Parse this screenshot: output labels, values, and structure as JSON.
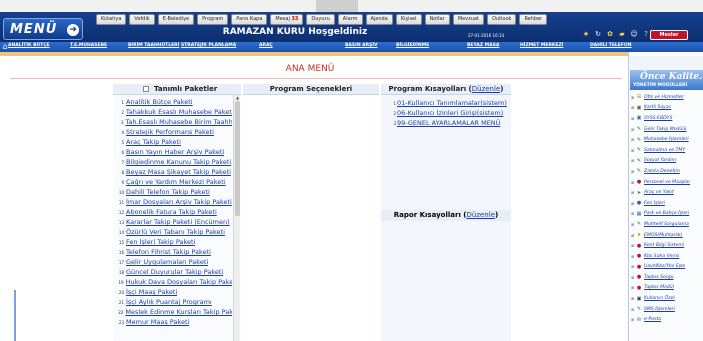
{
  "header": {
    "logo": "MENÜ",
    "welcome": "RAMAZAN KURU Hoşgeldiniz",
    "datetime": "27-01-2016 16:14",
    "user_badge": "Mesler",
    "menu_buttons": [
      {
        "label": "Kütahya",
        "badge": ""
      },
      {
        "label": "Vefdik",
        "badge": ""
      },
      {
        "label": "E-Belediye",
        "badge": ""
      },
      {
        "label": "Program",
        "badge": ""
      },
      {
        "label": "Pano Kapa",
        "badge": ""
      },
      {
        "label": "Mesaj",
        "badge": "33"
      },
      {
        "label": "Duyuru",
        "badge": ""
      },
      {
        "label": "Alarm",
        "badge": ""
      },
      {
        "label": "Ajanda",
        "badge": ""
      },
      {
        "label": "Kişisel",
        "badge": ""
      },
      {
        "label": "Notlar",
        "badge": ""
      },
      {
        "label": "Mevzuat",
        "badge": ""
      },
      {
        "label": "Outlook",
        "badge": ""
      },
      {
        "label": "Rehber",
        "badge": ""
      }
    ]
  },
  "shortcut_bar": [
    "ANALİTİK BÜTÇE",
    "T.E.MUHASEBE",
    "BİRİM TAAHHÜTLERİ",
    "STRATEJİK PLANLAMA",
    "ARAÇ",
    "BASIN ARŞİV",
    "BİLGİEDİNME",
    "BEYAZ MASA",
    "HİZMET MERKEZİ",
    "DAHİLİ TELEFON"
  ],
  "main": {
    "title": "ANA MENÜ",
    "col_packages": "Tanımlı Paketler",
    "col_options": "Program Seçenekleri",
    "col_shortcuts": "Program Kısayolları",
    "col_shortcuts_link": "Düzenle",
    "report_head": "Rapor Kısayolları",
    "report_link": "Düzenle",
    "packages": [
      {
        "n": "1",
        "label": "Analitik Bütçe Paketi"
      },
      {
        "n": "2",
        "label": "Tahakkuk Esaslı Muhasebe Paketi"
      },
      {
        "n": "3",
        "label": "Tah.Esaslı Muhasebe Birim Taahhüt"
      },
      {
        "n": "4",
        "label": "Stratejik Performans Paketi"
      },
      {
        "n": "5",
        "label": "Araç Takip Paketi"
      },
      {
        "n": "6",
        "label": "Basın Yayın Haber Arşiv Paketi"
      },
      {
        "n": "7",
        "label": "Bilgiedinme Kanunu Takip Paketi"
      },
      {
        "n": "8",
        "label": "Beyaz Masa Şikayet Takip Paketi"
      },
      {
        "n": "9",
        "label": "Çağrı ve Yardım Merkezi Paketi"
      },
      {
        "n": "10",
        "label": "Dahili Telefon Takip Paketi"
      },
      {
        "n": "11",
        "label": "İmar Dosyaları Arşiv Takip Paketi"
      },
      {
        "n": "12",
        "label": "Abonelik Fatura Takip Paketi"
      },
      {
        "n": "13",
        "label": "Kararlar Takip Paketi (Encümen)"
      },
      {
        "n": "14",
        "label": "Özürlü Veri Tabanı Takip Paketi"
      },
      {
        "n": "15",
        "label": "Fen İşleri Takip Paketi"
      },
      {
        "n": "16",
        "label": "Telefon Fihrist Takip Paketi"
      },
      {
        "n": "17",
        "label": "Gelir Uygulamaları Paketi"
      },
      {
        "n": "18",
        "label": "Güncel Duyurular Takip Paketi"
      },
      {
        "n": "19",
        "label": "Hukuk Dava Dosyaları Takip Paketi"
      },
      {
        "n": "20",
        "label": "İşçi Maaş Paketi"
      },
      {
        "n": "21",
        "label": "İşçi Aylık Puantaj Programı"
      },
      {
        "n": "22",
        "label": "Meslek Edinme Kursları Takip Paketi"
      },
      {
        "n": "23",
        "label": "Memur Maaş Paketi"
      }
    ],
    "shortcuts": [
      {
        "n": "1",
        "label": "01-Kullanıcı Tanımlamalar(sistem)"
      },
      {
        "n": "2",
        "label": "06-Kullanıcı İzinleri Girişi(sistem)"
      },
      {
        "n": "3",
        "label": "99-GENEL AYARLAMALAR MENÜ"
      }
    ]
  },
  "right_panel": {
    "banner_title": "Önce Kalite..",
    "banner_sub": "YÖNETİM MODÜLLERİ",
    "modules": [
      {
        "label": "Ofis ve Hizmetler",
        "icon": "⊞",
        "color": "#d08a00"
      },
      {
        "label": "Kartli Sayac",
        "icon": "▣",
        "color": "#555"
      },
      {
        "label": "SYSS-EBDYS",
        "icon": "▣",
        "color": "#2a5bc0"
      },
      {
        "label": "Gelir Takip Modülü",
        "icon": "✎",
        "color": "#1a7a2a"
      },
      {
        "label": "Muhasebe İşlemleri",
        "icon": "✎",
        "color": "#1a7a2a"
      },
      {
        "label": "Satınalma ve TMY",
        "icon": "✎",
        "color": "#1a7a2a"
      },
      {
        "label": "Sosyal Yardım",
        "icon": "✎",
        "color": "#1a7a2a"
      },
      {
        "label": "Zabıta Denetim",
        "icon": "✎",
        "color": "#1a7a2a"
      },
      {
        "label": "Personel ve Maaşlar",
        "icon": "●",
        "color": "#c0122a"
      },
      {
        "label": "Araç ve Yakıt",
        "icon": "➤",
        "color": "#555"
      },
      {
        "label": "Fen İşleri",
        "icon": "●",
        "color": "#2a5bc0"
      },
      {
        "label": "Park ve Bahçe İşleri",
        "icon": "▦",
        "color": "#2a5bc0"
      },
      {
        "label": "Muhtelif Sorgulama",
        "icon": "✎",
        "color": "#1a7a2a"
      },
      {
        "label": "EMOS(Muhtarlık)",
        "icon": "★",
        "color": "#d08a00"
      },
      {
        "label": "Kent Bilgi Sistemi",
        "icon": "●",
        "color": "#c0122a"
      },
      {
        "label": "Kbs Saha Verisi",
        "icon": "●",
        "color": "#c0122a"
      },
      {
        "label": "Uavt/Kbs/Ybs Eşle",
        "icon": "●",
        "color": "#c0122a"
      },
      {
        "label": "Tapbıs Sorgu",
        "icon": "●",
        "color": "#c0122a"
      },
      {
        "label": "Tapbıs Modül",
        "icon": "●",
        "color": "#c0122a"
      },
      {
        "label": "Kullanıcı Özel",
        "icon": "▣",
        "color": "#333"
      },
      {
        "label": "SMS İşlemleri",
        "icon": "✎",
        "color": "#1a7a2a"
      },
      {
        "label": "e-Posta",
        "icon": "✉",
        "color": "#555"
      }
    ]
  }
}
